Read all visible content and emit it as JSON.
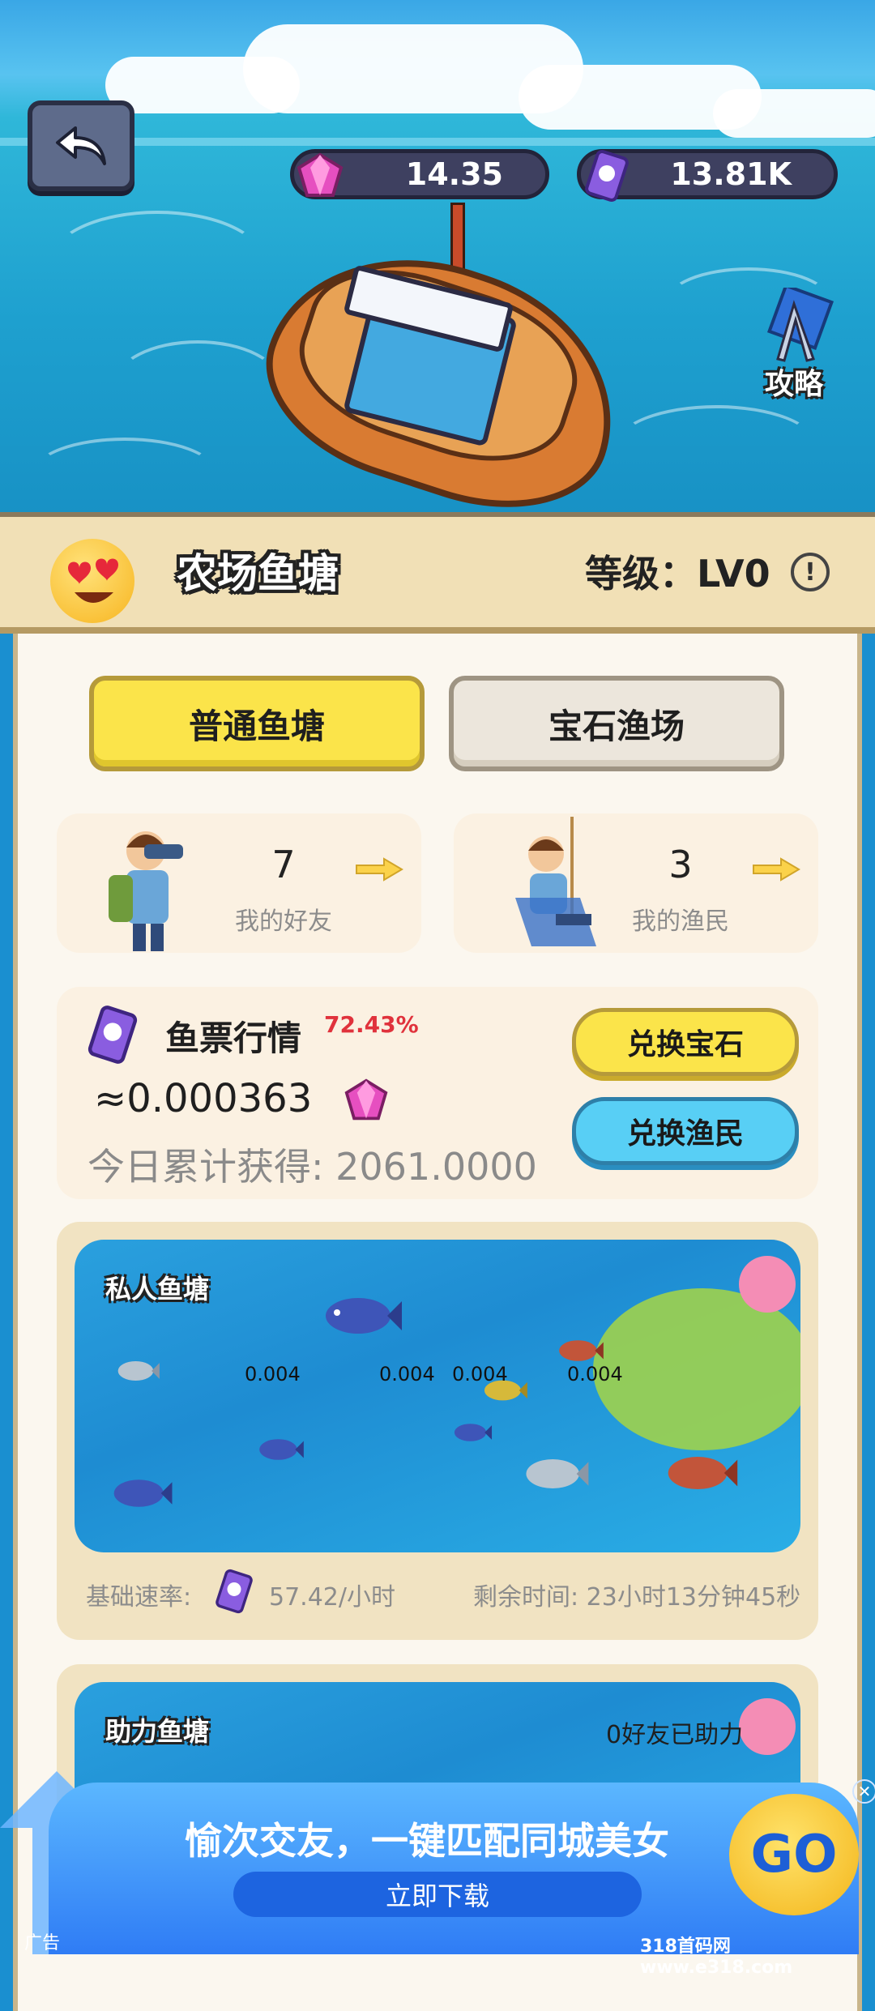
{
  "topbar": {
    "gems_value": "14.35",
    "tickets_value": "13.81K",
    "guide_label": "攻略"
  },
  "header": {
    "title": "农场鱼塘",
    "level_text": "等级：LV0",
    "info_glyph": "!"
  },
  "tabs": [
    {
      "label": "普通鱼塘",
      "active": true
    },
    {
      "label": "宝石渔场",
      "active": false
    }
  ],
  "stats": {
    "friends_count": "7",
    "friends_label": "我的好友",
    "fishermen_count": "3",
    "fishermen_label": "我的渔民"
  },
  "market": {
    "title": "鱼票行情",
    "change": "72.43%",
    "rate": "≈0.000363",
    "today_label": "今日累计获得:",
    "today_value": "2061.0000",
    "exchange_gem_label": "兑换宝石",
    "exchange_fisher_label": "兑换渔民"
  },
  "private_pond": {
    "title": "私人鱼塘",
    "fish_values": [
      "0.004",
      "0.004",
      "0.004",
      "0.004"
    ],
    "base_rate_label": "基础速率:",
    "base_rate_value": "57.42/小时",
    "remaining_label": "剩余时间:",
    "remaining_value": "23小时13分钟45秒"
  },
  "assist_pond": {
    "title": "助力鱼塘",
    "assist_text": "0好友已助力"
  },
  "ad": {
    "headline": "愉次交友，一键匹配同城美女",
    "download_label": "立即下载",
    "go_label": "GO",
    "ad_tag": "广告",
    "close_glyph": "✕"
  },
  "watermark": "318首码网 www.e318.com",
  "colors": {
    "accent_yellow": "#fbe44a",
    "accent_blue": "#58cff5",
    "gem_pink": "#e64fc0",
    "change_red": "#e0323c",
    "banner_bg": "#f1e0b6"
  },
  "icons": [
    "back-arrow-icon",
    "gem-icon",
    "ticket-icon",
    "guide-compass-icon",
    "info-icon",
    "arrow-right-icon",
    "close-icon"
  ]
}
